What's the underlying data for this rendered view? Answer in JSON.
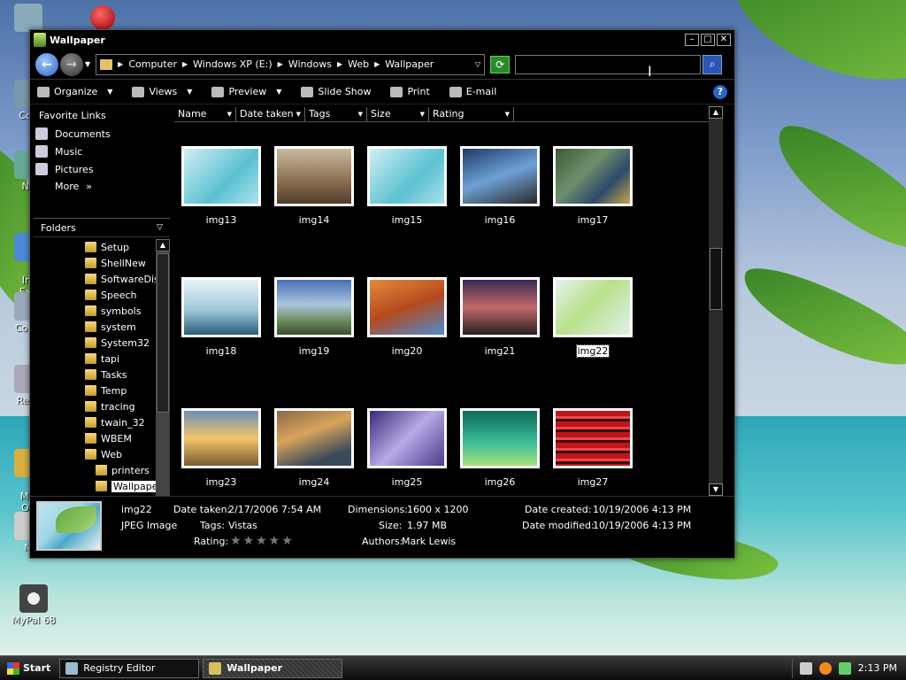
{
  "desktop": {
    "icons": [
      {
        "label": "Con"
      },
      {
        "label": "Ne"
      },
      {
        "label": "Int\nExp"
      },
      {
        "label": "Contr"
      },
      {
        "label": "Recy"
      },
      {
        "label": "Mic\nOu"
      },
      {
        "label": "M"
      },
      {
        "label": "MyPal 68"
      }
    ]
  },
  "window": {
    "title": "Wallpaper",
    "controls": {
      "minimize": "–",
      "maximize": "□",
      "close": "✕"
    },
    "address": {
      "crumbs": [
        "Computer",
        "Windows XP (E:)",
        "Windows",
        "Web",
        "Wallpaper"
      ],
      "search_value": ""
    },
    "toolbar": {
      "organize": "Organize",
      "views": "Views",
      "preview": "Preview",
      "slideshow": "Slide Show",
      "print": "Print",
      "email": "E-mail",
      "help": "?"
    },
    "favorites": {
      "header": "Favorite Links",
      "items": [
        "Documents",
        "Music",
        "Pictures"
      ],
      "more": "More"
    },
    "folders": {
      "header": "Folders",
      "items": [
        "Setup",
        "ShellNew",
        "SoftwareDis",
        "Speech",
        "symbols",
        "system",
        "System32",
        "tapi",
        "Tasks",
        "Temp",
        "tracing",
        "twain_32",
        "WBEM",
        "Web"
      ],
      "sub_items": [
        "printers",
        "Wallpaper"
      ],
      "selected": "Wallpaper"
    },
    "columns": [
      "Name",
      "Date taken",
      "Tags",
      "Size",
      "Rating"
    ],
    "files": [
      {
        "name": "img13"
      },
      {
        "name": "img14"
      },
      {
        "name": "img15"
      },
      {
        "name": "img16"
      },
      {
        "name": "img17"
      },
      {
        "name": "img18"
      },
      {
        "name": "img19"
      },
      {
        "name": "img20"
      },
      {
        "name": "img21"
      },
      {
        "name": "img22"
      },
      {
        "name": "img23"
      },
      {
        "name": "img24"
      },
      {
        "name": "img25"
      },
      {
        "name": "img26"
      },
      {
        "name": "img27"
      }
    ],
    "selected_file": "img22",
    "details": {
      "name": "img22",
      "type": "JPEG Image",
      "date_taken_label": "Date taken:",
      "date_taken": "2/17/2006 7:54 AM",
      "tags_label": "Tags:",
      "tags": "Vistas",
      "rating_label": "Rating:",
      "rating": 0,
      "dimensions_label": "Dimensions:",
      "dimensions": "1600 x 1200",
      "size_label": "Size:",
      "size": "1.97 MB",
      "authors_label": "Authors:",
      "authors": "Mark Lewis",
      "date_created_label": "Date created:",
      "date_created": "10/19/2006 4:13 PM",
      "date_modified_label": "Date modified:",
      "date_modified": "10/19/2006 4:13 PM"
    }
  },
  "taskbar": {
    "start": "Start",
    "tasks": [
      {
        "label": "Registry Editor",
        "active": false
      },
      {
        "label": "Wallpaper",
        "active": true
      }
    ],
    "clock": "2:13 PM"
  }
}
